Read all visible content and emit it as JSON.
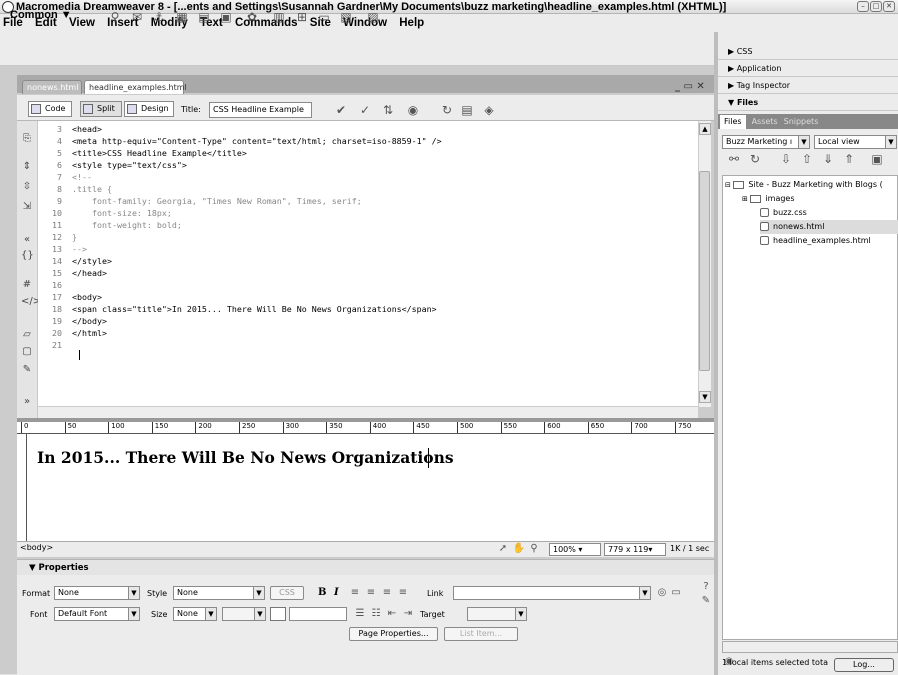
{
  "window": {
    "title": "Macromedia Dreamweaver 8 - [...ents and Settings\\Susannah Gardner\\My Documents\\buzz marketing\\headline_examples.html (XHTML)]"
  },
  "menu": [
    "File",
    "Edit",
    "View",
    "Insert",
    "Modify",
    "Text",
    "Commands",
    "Site",
    "Window",
    "Help"
  ],
  "insert_bar": {
    "category": "Common ▼"
  },
  "doc_tabs": [
    "nonews.html",
    "headline_examples.html"
  ],
  "doc_toolbar": {
    "code": "Code",
    "split": "Split",
    "design": "Design",
    "title_label": "Title:",
    "title_value": "CSS Headline Example"
  },
  "code_lines": [
    {
      "n": "3",
      "text": "<head>"
    },
    {
      "n": "4",
      "text": "<meta http-equiv=\"Content-Type\" content=\"text/html; charset=iso-8859-1\" />"
    },
    {
      "n": "5",
      "text": "<title>CSS Headline Example</title>"
    },
    {
      "n": "6",
      "text": "<style type=\"text/css\">"
    },
    {
      "n": "7",
      "text": "<!--"
    },
    {
      "n": "8",
      "text": ".title {"
    },
    {
      "n": "9",
      "text": "    font-family: Georgia, \"Times New Roman\", Times, serif;"
    },
    {
      "n": "10",
      "text": "    font-size: 18px;"
    },
    {
      "n": "11",
      "text": "    font-weight: bold;"
    },
    {
      "n": "12",
      "text": "}"
    },
    {
      "n": "13",
      "text": "-->"
    },
    {
      "n": "14",
      "text": "</style>"
    },
    {
      "n": "15",
      "text": "</head>"
    },
    {
      "n": "16",
      "text": ""
    },
    {
      "n": "17",
      "text": "<body>"
    },
    {
      "n": "18",
      "text": "<span class=\"title\">In 2015... There Will Be No News Organizations</span>"
    },
    {
      "n": "19",
      "text": "</body>"
    },
    {
      "n": "20",
      "text": "</html>"
    },
    {
      "n": "21",
      "text": ""
    }
  ],
  "ruler": [
    "0",
    "50",
    "100",
    "150",
    "200",
    "250",
    "300",
    "350",
    "400",
    "450",
    "500",
    "550",
    "600",
    "650",
    "700",
    "750"
  ],
  "design_view": {
    "heading": "In 2015... There Will Be No News Organizations"
  },
  "status_bar": {
    "tag": "<body>",
    "zoom": "100%",
    "size": "779 x 119",
    "weight": "1K / 1 sec"
  },
  "properties": {
    "header": "▼ Properties",
    "format_label": "Format",
    "format_value": "None",
    "style_label": "Style",
    "style_value": "None",
    "css_button": "CSS",
    "bold": "B",
    "italic": "I",
    "link_label": "Link",
    "font_label": "Font",
    "font_value": "Default Font",
    "size_label": "Size",
    "size_value": "None",
    "target_label": "Target",
    "page_properties": "Page Properties...",
    "list_item": "List Item..."
  },
  "panels": {
    "css": "▶ CSS",
    "application": "▶ Application",
    "tag_inspector": "▶ Tag Inspector",
    "files": "▼ Files",
    "tabs": [
      "Files",
      "Assets",
      "Snippets"
    ],
    "site": "Buzz Marketing ı",
    "view": "Local view",
    "tree": {
      "site": "Site - Buzz Marketing with Blogs (",
      "items": [
        "images",
        "buzz.css",
        "nonews.html",
        "headline_examples.html"
      ]
    },
    "status": "1 local items selected tota",
    "log": "Log..."
  },
  "colors": {
    "selection": "#dcdcdc",
    "code_comment": "#888888"
  }
}
